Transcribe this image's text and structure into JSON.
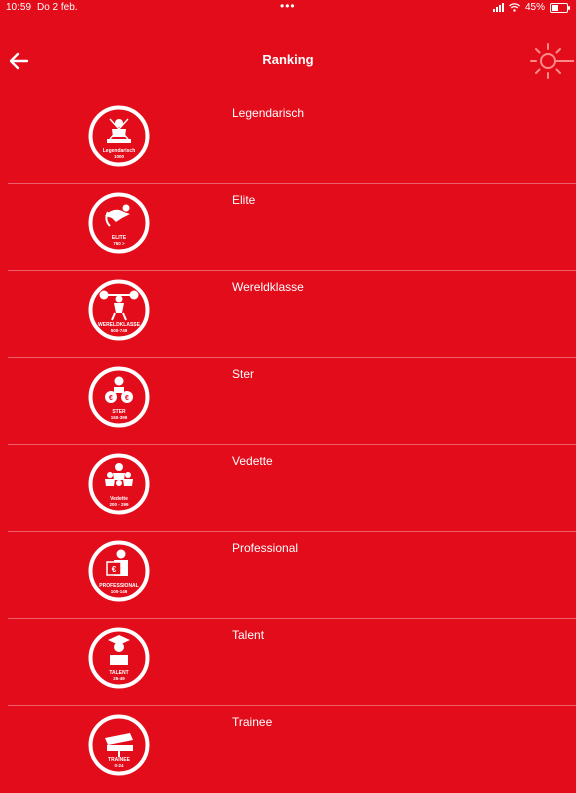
{
  "status": {
    "time": "10:59",
    "date": "Do 2 feb.",
    "battery": "45%",
    "battery_level": 0.45
  },
  "header": {
    "title": "Ranking"
  },
  "ranks": [
    {
      "label": "Legendarisch",
      "badge_text": "Legendarisch",
      "badge_range": "1000"
    },
    {
      "label": "Elite",
      "badge_text": "ELITE",
      "badge_range": "750 >"
    },
    {
      "label": "Wereldklasse",
      "badge_text": "WERELDKLASSE",
      "badge_range": "500-749"
    },
    {
      "label": "Ster",
      "badge_text": "STER",
      "badge_range": "150-399"
    },
    {
      "label": "Vedette",
      "badge_text": "Vedette",
      "badge_range": "200 - 299"
    },
    {
      "label": "Professional",
      "badge_text": "PROFESSIONAL",
      "badge_range": "100-149"
    },
    {
      "label": "Talent",
      "badge_text": "TALENT",
      "badge_range": "25-49"
    },
    {
      "label": "Trainee",
      "badge_text": "TRAINEE",
      "badge_range": "0-24"
    }
  ]
}
